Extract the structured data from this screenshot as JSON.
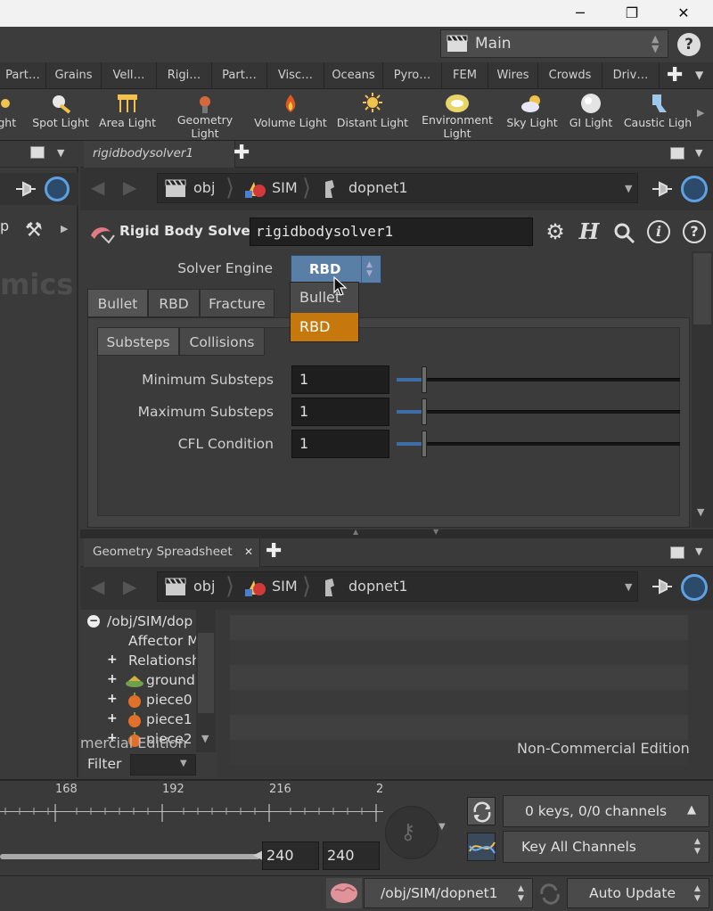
{
  "window": {
    "minimize_glyph": "─",
    "restore_glyph": "❐",
    "close_glyph": "✕"
  },
  "desktop": {
    "label": "Main",
    "help_glyph": "?"
  },
  "shelf_tabs": [
    "Part…",
    "Grains",
    "Vell…",
    "Rigi…",
    "Part…",
    "Visc…",
    "Oceans",
    "Pyro…",
    "FEM",
    "Wires",
    "Crowds",
    "Driv…"
  ],
  "shelf_tools": [
    {
      "label": "ight",
      "icon": "light-icon"
    },
    {
      "label": "Spot Light",
      "icon": "spot-light-icon"
    },
    {
      "label": "Area Light",
      "icon": "area-light-icon"
    },
    {
      "label": "Geometry\nLight",
      "icon": "geometry-light-icon"
    },
    {
      "label": "Volume Light",
      "icon": "volume-light-icon"
    },
    {
      "label": "Distant Light",
      "icon": "distant-light-icon"
    },
    {
      "label": "Environment\nLight",
      "icon": "environment-light-icon"
    },
    {
      "label": "Sky Light",
      "icon": "sky-light-icon"
    },
    {
      "label": "GI Light",
      "icon": "gi-light-icon"
    },
    {
      "label": "Caustic Ligh",
      "icon": "caustic-light-icon"
    }
  ],
  "left_panel": {
    "partial_label": "p",
    "watermark": "mics"
  },
  "param_pane": {
    "tab_title": "rigidbodysolver1",
    "path": {
      "obj": "obj",
      "sim": "SIM",
      "node": "dopnet1"
    },
    "node_type": "Rigid Body Solver",
    "node_name": "rigidbodysolver1",
    "solver_engine_label": "Solver Engine",
    "solver_engine_value": "RBD",
    "dropdown_options": [
      "Bullet",
      "RBD"
    ],
    "dropdown_highlight": "RBD",
    "main_tabs": [
      "Bullet",
      "RBD",
      "Fracture"
    ],
    "sub_tabs": [
      "Substeps",
      "Collisions"
    ],
    "params": [
      {
        "label": "Minimum Substeps",
        "value": "1"
      },
      {
        "label": "Maximum Substeps",
        "value": "1"
      },
      {
        "label": "CFL Condition",
        "value": "1"
      }
    ]
  },
  "spreadsheet_pane": {
    "tab_title": "Geometry Spreadsheet",
    "path": {
      "obj": "obj",
      "sim": "SIM",
      "node": "dopnet1"
    },
    "tree": [
      {
        "label": "/obj/SIM/dop",
        "expander": "−"
      },
      {
        "label": "Affector M",
        "expander": ""
      },
      {
        "label": "Relationsh",
        "expander": "+"
      },
      {
        "label": "ground",
        "expander": "+"
      },
      {
        "label": "piece0",
        "expander": "+"
      },
      {
        "label": "piece1",
        "expander": "+"
      },
      {
        "label": "piece2",
        "expander": "+"
      }
    ],
    "filter_label": "Filter",
    "watermark_left": "mercial Edition",
    "watermark": "Non-Commercial Edition"
  },
  "timeline": {
    "ticks": [
      "168",
      "192",
      "216",
      "2"
    ],
    "end_frame": "240",
    "end_frame2": "240",
    "keys_info": "0 keys, 0/0 channels",
    "key_all_label": "Key All Channels"
  },
  "statusbar": {
    "path": "/obj/SIM/dopnet1",
    "update_mode": "Auto Update"
  },
  "colors": {
    "accent_orange": "#c7780c",
    "selected_blue": "#5a7fa6"
  }
}
